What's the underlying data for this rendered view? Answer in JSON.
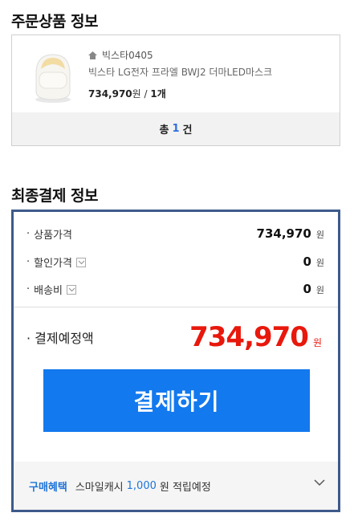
{
  "order_section": {
    "title": "주문상품 정보",
    "seller": "빅스타0405",
    "product_name": "빅스타 LG전자 프라엘 BWJ2 더마LED마스크",
    "price": "734,970",
    "price_unit": "원",
    "quantity": "1개",
    "count_prefix": "총",
    "count": "1",
    "count_suffix": "건"
  },
  "payment_section": {
    "title": "최종결제 정보",
    "rows": [
      {
        "label": "상품가격",
        "value": "734,970",
        "unit": "원"
      },
      {
        "label": "할인가격",
        "value": "0",
        "unit": "원"
      },
      {
        "label": "배송비",
        "value": "0",
        "unit": "원"
      }
    ],
    "total_label": "결제예정액",
    "total_value": "734,970",
    "total_unit": "원",
    "pay_button": "결제하기",
    "benefit": {
      "tag": "구매혜택",
      "text_pre": "스마일캐시",
      "amount": "1,000",
      "text_post": "원 적립예정"
    }
  },
  "colors": {
    "accent_blue": "#1379ee",
    "price_red": "#e8180c",
    "box_border": "#3d5a8a"
  },
  "icons": [
    "home-icon",
    "product-mask-image",
    "dropdown-check-icon",
    "chevron-down-icon"
  ]
}
